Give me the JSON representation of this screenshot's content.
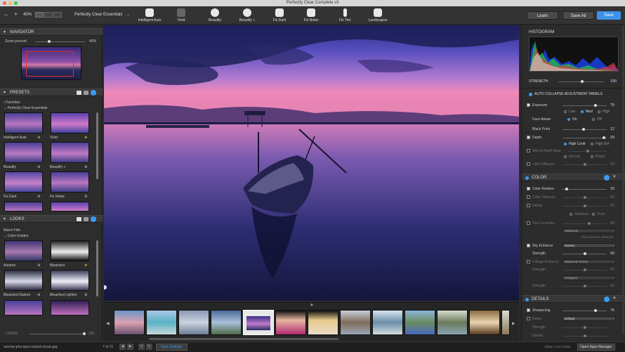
{
  "app": {
    "title": "Perfectly Clear Complete v3"
  },
  "toolbar": {
    "zoom": "40%",
    "preset_name": "Perfectly Clear Essentials",
    "tools": [
      {
        "label": "Intelligent Auto",
        "icon": "brush-hd-icon"
      },
      {
        "label": "Vivid",
        "icon": "brush-icon"
      },
      {
        "label": "Beautify",
        "icon": "face-icon"
      },
      {
        "label": "Beautify +",
        "icon": "face-plus-icon"
      },
      {
        "label": "Fix Dark",
        "icon": "fix-dark-icon"
      },
      {
        "label": "Fix Noise",
        "icon": "fix-noise-icon"
      },
      {
        "label": "Fix Tint",
        "icon": "thermometer-icon"
      },
      {
        "label": "Landscapes",
        "icon": "landscape-icon"
      }
    ],
    "learn": "Learn",
    "save_all": "Save All",
    "save": "Save"
  },
  "navigator": {
    "title": "NAVIGATOR",
    "zoom_label": "Zoom percent",
    "zoom_value": "40%"
  },
  "presets": {
    "title": "PRESETS",
    "favorites": "Favorites",
    "group": "Perfectly Clear Essentials",
    "items": [
      {
        "label": "Intelligent Auto",
        "mark": "gear-icon"
      },
      {
        "label": "Vivid",
        "mark": "star-icon"
      },
      {
        "label": "Beautify",
        "mark": "gear-icon"
      },
      {
        "label": "Beautify +",
        "mark": "gear-icon"
      },
      {
        "label": "Fix Dark",
        "mark": "gear-icon"
      },
      {
        "label": "Fix Noise",
        "mark": "gear-icon"
      }
    ]
  },
  "looks": {
    "title": "LOOKS",
    "group1": "Warm Film",
    "group2": "Color Grades",
    "items": [
      {
        "label": "Autumn",
        "mark": "gear-icon"
      },
      {
        "label": "Bleached",
        "mark": "star-icon"
      },
      {
        "label": "Bleached Darken",
        "mark": "gear-icon"
      },
      {
        "label": "Bleached Lighten",
        "mark": "gear-icon"
      }
    ],
    "footer_label": "LOOKS",
    "footer_value": "100"
  },
  "histogram": {
    "title": "HISTOGRAM",
    "strength_label": "STRENGTH",
    "strength_value": "100",
    "strength_level": 1.0
  },
  "adjust": {
    "auto_collapse": "AUTO COLLAPSE ADJUSTMENT PANELS",
    "exposure": {
      "label": "Exposure",
      "value": "75",
      "level": 0.75
    },
    "exposure_modes": [
      "Low",
      "Med",
      "High"
    ],
    "face_aware": {
      "label": "Face Aware",
      "on": "On",
      "off": "Off"
    },
    "black_point": {
      "label": "Black Point",
      "value": "12",
      "level": 0.62
    },
    "depth": {
      "label": "Depth",
      "value": "93",
      "level": 0.93
    },
    "depth_modes": [
      "High Contr",
      "High Def"
    ],
    "skin": {
      "label": "Skin & Depth Bias",
      "value": "",
      "modes": [
        "Normal",
        "Bright"
      ]
    },
    "light_diffusion": {
      "label": "Light Diffusion",
      "value": "50"
    }
  },
  "color": {
    "title": "COLOR",
    "color_restore": {
      "label": "Color Restore",
      "value": "15",
      "level": 0.15
    },
    "color_vibrancy": {
      "label": "Color Vibrancy",
      "value": "50"
    },
    "infinity": {
      "label": "Infinity",
      "value": "50",
      "modes": [
        "Standard",
        "Vivid"
      ]
    },
    "tint_correction": {
      "label": "Tint Correction",
      "value": "60",
      "dropdown": "Maximum",
      "note": "This has been detected"
    },
    "sky_enhance": {
      "label": "Sky Enhance",
      "dropdown": "Sunset"
    },
    "sky_strength": {
      "label": "Strength",
      "value": "50",
      "level": 0.5
    },
    "foliage": {
      "label": "Foliage Enhance",
      "dropdown": "Maximum Green"
    },
    "foliage_strength": {
      "label": "Strength",
      "value": "50"
    },
    "foliage_category": {
      "dropdown": "Category"
    },
    "foliage_strength2": {
      "label": "Strength",
      "value": "50"
    }
  },
  "details": {
    "title": "DETAILS",
    "sharpening": {
      "label": "Sharpening",
      "value": "75",
      "level": 0.75
    },
    "noise": {
      "label": "Noise",
      "dropdown": "Default"
    },
    "strength": {
      "label": "Strength",
      "value": ""
    },
    "details_label": {
      "label": "Details",
      "value": ""
    }
  },
  "status": {
    "filename": "sunrise-phu-quoc-island-ocean.jpg",
    "count": "7 of 21",
    "sync": "Sync Settings",
    "version": "Athlon v3.3.0.1064",
    "apps_manager": "Open Apps Manager"
  },
  "colors": {
    "accent": "#3a9bf0",
    "save_button": "#3b93e8",
    "panel": "#2c2c2c"
  }
}
